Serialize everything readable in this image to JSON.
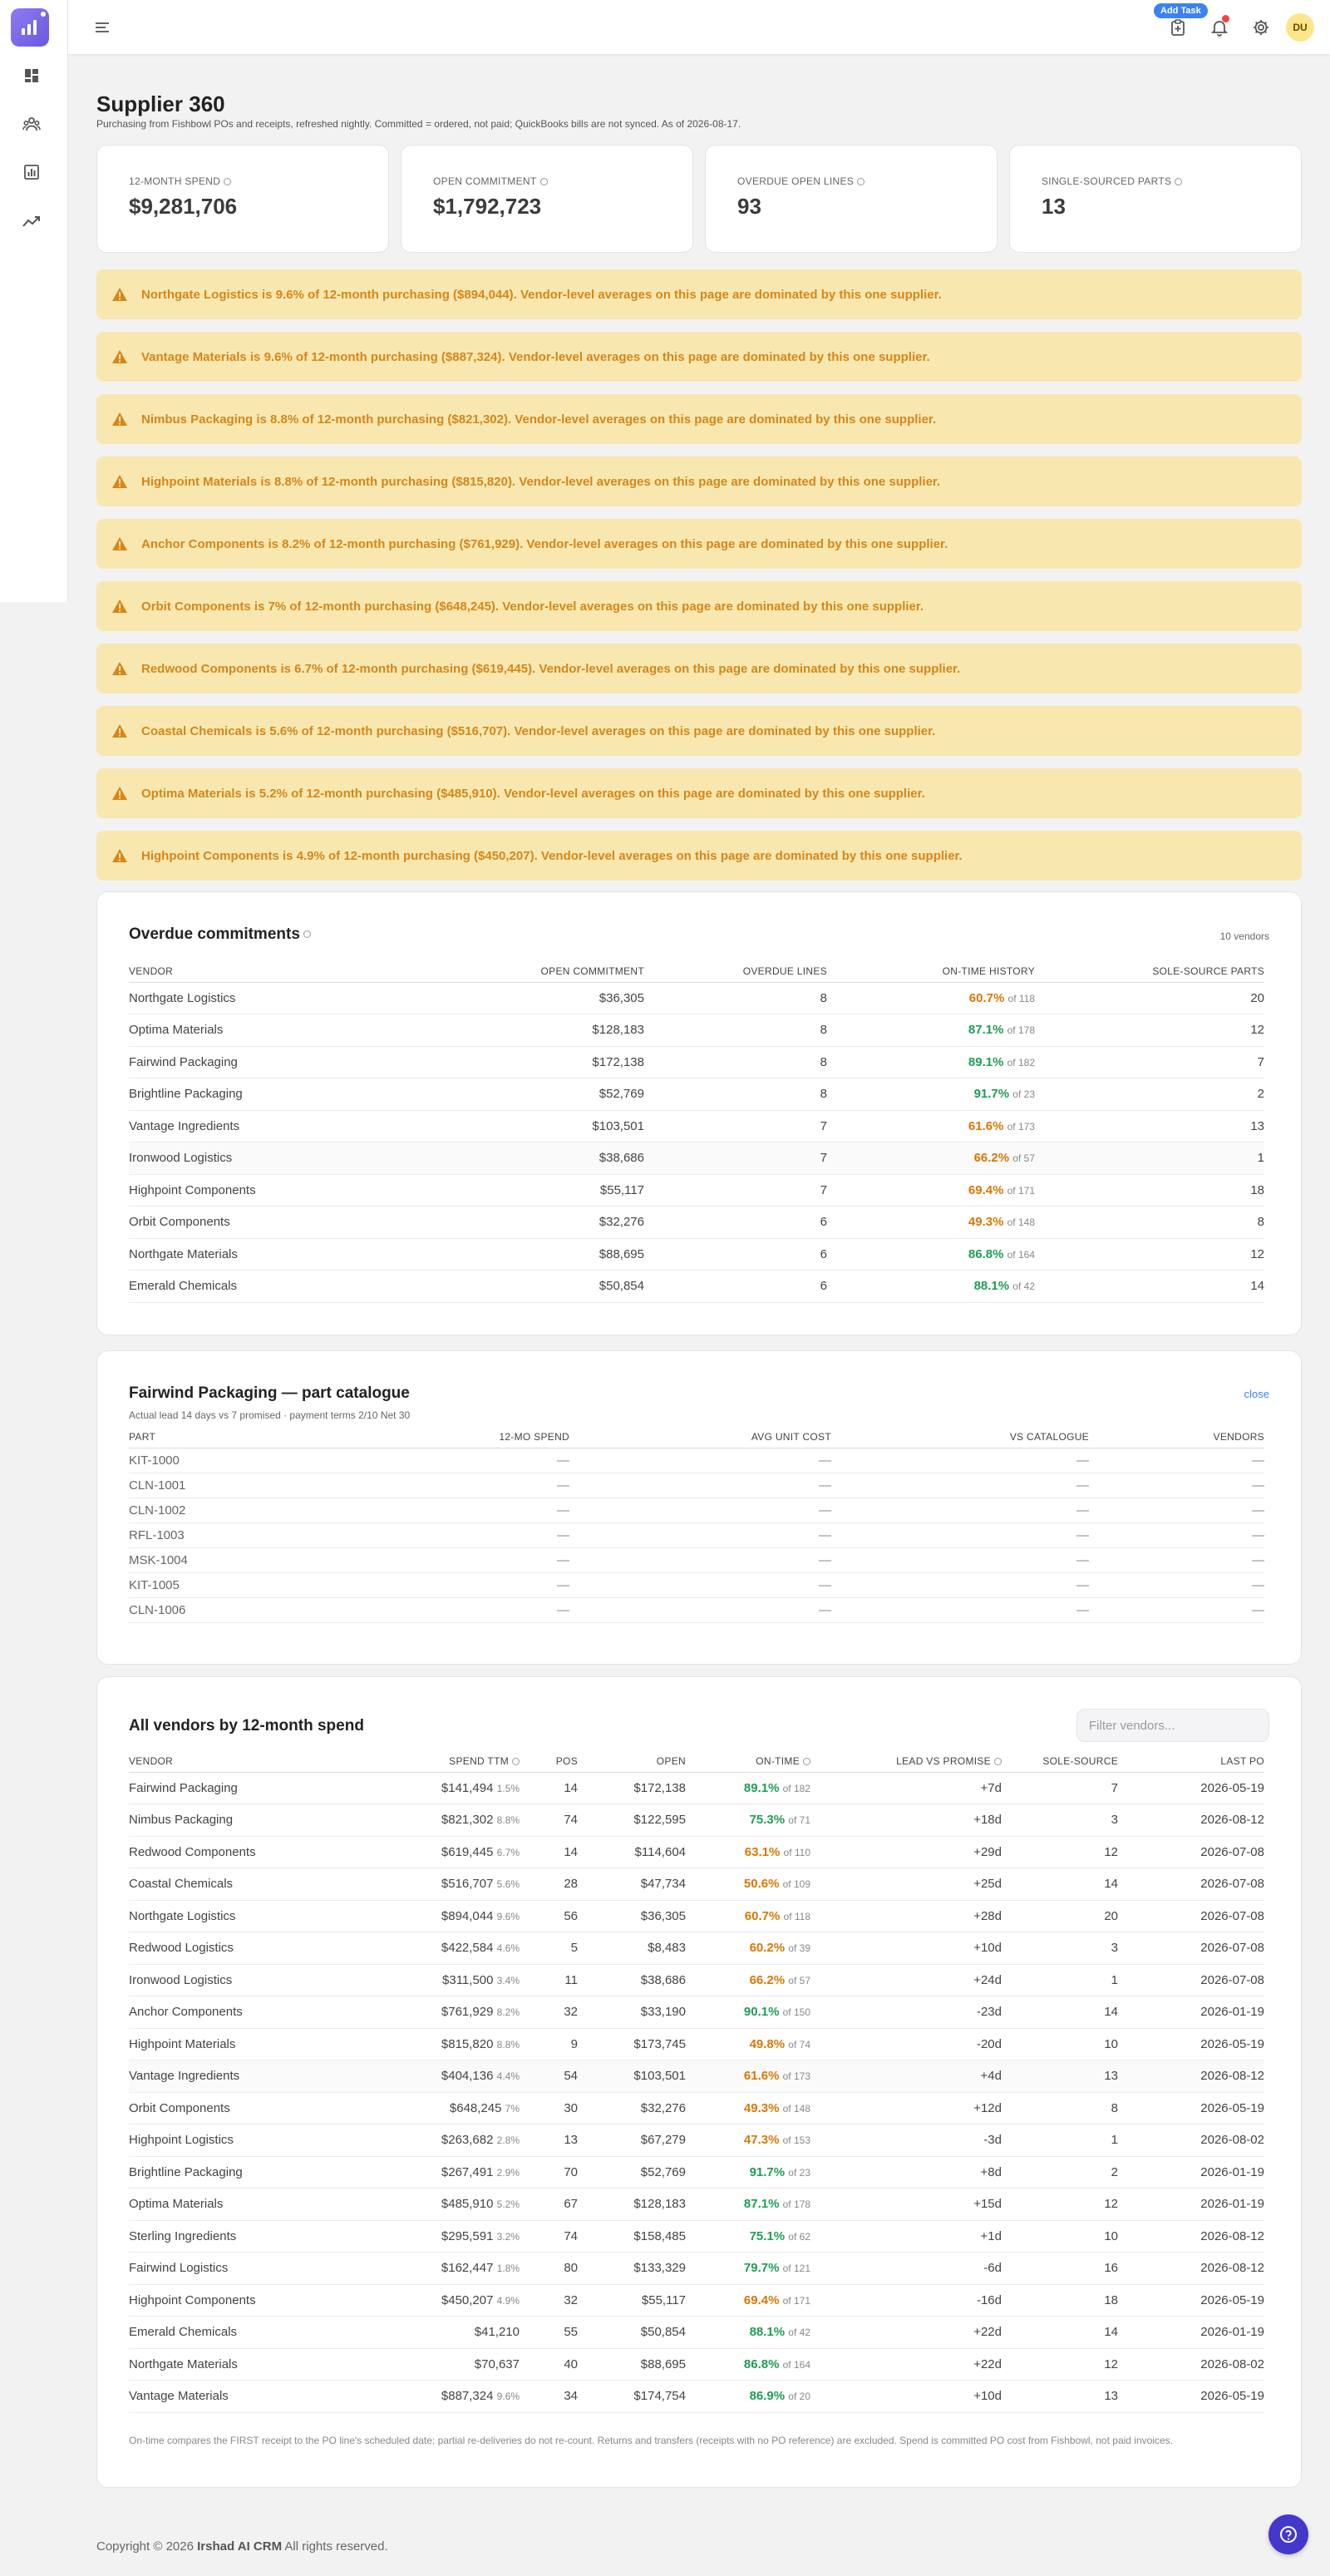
{
  "topbar": {
    "add_task_label": "Add Task",
    "avatar_initials": "DU"
  },
  "page": {
    "title": "Supplier 360",
    "subtitle": "Purchasing from Fishbowl POs and receipts, refreshed nightly. Committed = ordered, not paid; QuickBooks bills are not synced. As of 2026-08-17."
  },
  "kpis": [
    {
      "label": "12-MONTH SPEND",
      "value": "$9,281,706"
    },
    {
      "label": "OPEN COMMITMENT",
      "value": "$1,792,723"
    },
    {
      "label": "OVERDUE OPEN LINES",
      "value": "93"
    },
    {
      "label": "SINGLE-SOURCED PARTS",
      "value": "13"
    }
  ],
  "alerts": [
    "Northgate Logistics is 9.6% of 12-month purchasing ($894,044). Vendor-level averages on this page are dominated by this one supplier.",
    "Vantage Materials is 9.6% of 12-month purchasing ($887,324). Vendor-level averages on this page are dominated by this one supplier.",
    "Nimbus Packaging is 8.8% of 12-month purchasing ($821,302). Vendor-level averages on this page are dominated by this one supplier.",
    "Highpoint Materials is 8.8% of 12-month purchasing ($815,820). Vendor-level averages on this page are dominated by this one supplier.",
    "Anchor Components is 8.2% of 12-month purchasing ($761,929). Vendor-level averages on this page are dominated by this one supplier.",
    "Orbit Components is 7% of 12-month purchasing ($648,245). Vendor-level averages on this page are dominated by this one supplier.",
    "Redwood Components is 6.7% of 12-month purchasing ($619,445). Vendor-level averages on this page are dominated by this one supplier.",
    "Coastal Chemicals is 5.6% of 12-month purchasing ($516,707). Vendor-level averages on this page are dominated by this one supplier.",
    "Optima Materials is 5.2% of 12-month purchasing ($485,910). Vendor-level averages on this page are dominated by this one supplier.",
    "Highpoint Components is 4.9% of 12-month purchasing ($450,207). Vendor-level averages on this page are dominated by this one supplier."
  ],
  "overdue": {
    "title": "Overdue commitments",
    "count": "10 vendors",
    "columns": [
      "VENDOR",
      "OPEN COMMITMENT",
      "OVERDUE LINES",
      "ON-TIME HISTORY",
      "SOLE-SOURCE PARTS"
    ],
    "rows": [
      {
        "vendor": "Northgate Logistics",
        "open": "$36,305",
        "lines": "8",
        "ontime": "60.7%",
        "of": "of 118",
        "tone": "warn",
        "sole": "20"
      },
      {
        "vendor": "Optima Materials",
        "open": "$128,183",
        "lines": "8",
        "ontime": "87.1%",
        "of": "of 178",
        "tone": "good",
        "sole": "12"
      },
      {
        "vendor": "Fairwind Packaging",
        "open": "$172,138",
        "lines": "8",
        "ontime": "89.1%",
        "of": "of 182",
        "tone": "good",
        "sole": "7"
      },
      {
        "vendor": "Brightline Packaging",
        "open": "$52,769",
        "lines": "8",
        "ontime": "91.7%",
        "of": "of 23",
        "tone": "good",
        "sole": "2"
      },
      {
        "vendor": "Vantage Ingredients",
        "open": "$103,501",
        "lines": "7",
        "ontime": "61.6%",
        "of": "of 173",
        "tone": "warn",
        "sole": "13"
      },
      {
        "vendor": "Ironwood Logistics",
        "open": "$38,686",
        "lines": "7",
        "ontime": "66.2%",
        "of": "of 57",
        "tone": "warn",
        "sole": "1"
      },
      {
        "vendor": "Highpoint Components",
        "open": "$55,117",
        "lines": "7",
        "ontime": "69.4%",
        "of": "of 171",
        "tone": "warn",
        "sole": "18"
      },
      {
        "vendor": "Orbit Components",
        "open": "$32,276",
        "lines": "6",
        "ontime": "49.3%",
        "of": "of 148",
        "tone": "warn",
        "sole": "8"
      },
      {
        "vendor": "Northgate Materials",
        "open": "$88,695",
        "lines": "6",
        "ontime": "86.8%",
        "of": "of 164",
        "tone": "good",
        "sole": "12"
      },
      {
        "vendor": "Emerald Chemicals",
        "open": "$50,854",
        "lines": "6",
        "ontime": "88.1%",
        "of": "of 42",
        "tone": "good",
        "sole": "14"
      }
    ]
  },
  "catalogue": {
    "title": "Fairwind Packaging — part catalogue",
    "subtitle": "Actual lead 14 days vs 7 promised · payment terms 2/10 Net 30",
    "close_label": "close",
    "columns": [
      "PART",
      "12-MO SPEND",
      "AVG UNIT COST",
      "VS CATALOGUE",
      "VENDORS"
    ],
    "dash": "—",
    "parts": [
      "KIT-1000",
      "CLN-1001",
      "CLN-1002",
      "RFL-1003",
      "MSK-1004",
      "KIT-1005",
      "CLN-1006"
    ]
  },
  "vendors": {
    "title": "All vendors by 12-month spend",
    "filter_placeholder": "Filter vendors...",
    "columns": [
      "VENDOR",
      "SPEND TTM",
      "POS",
      "OPEN",
      "ON-TIME",
      "LEAD VS PROMISE",
      "SOLE-SOURCE",
      "LAST PO"
    ],
    "rows": [
      {
        "vendor": "Fairwind Packaging",
        "spend": "$141,494",
        "pct": "1.5%",
        "pos": "14",
        "open": "$172,138",
        "ontime": "89.1%",
        "of": "of 182",
        "tone": "good",
        "lead": "+7d",
        "sole": "7",
        "last": "2026-05-19"
      },
      {
        "vendor": "Nimbus Packaging",
        "spend": "$821,302",
        "pct": "8.8%",
        "pos": "74",
        "open": "$122,595",
        "ontime": "75.3%",
        "of": "of 71",
        "tone": "good",
        "lead": "+18d",
        "sole": "3",
        "last": "2026-08-12"
      },
      {
        "vendor": "Redwood Components",
        "spend": "$619,445",
        "pct": "6.7%",
        "pos": "14",
        "open": "$114,604",
        "ontime": "63.1%",
        "of": "of 110",
        "tone": "warn",
        "lead": "+29d",
        "sole": "12",
        "last": "2026-07-08"
      },
      {
        "vendor": "Coastal Chemicals",
        "spend": "$516,707",
        "pct": "5.6%",
        "pos": "28",
        "open": "$47,734",
        "ontime": "50.6%",
        "of": "of 109",
        "tone": "warn",
        "lead": "+25d",
        "sole": "14",
        "last": "2026-07-08"
      },
      {
        "vendor": "Northgate Logistics",
        "spend": "$894,044",
        "pct": "9.6%",
        "pos": "56",
        "open": "$36,305",
        "ontime": "60.7%",
        "of": "of 118",
        "tone": "warn",
        "lead": "+28d",
        "sole": "20",
        "last": "2026-07-08"
      },
      {
        "vendor": "Redwood Logistics",
        "spend": "$422,584",
        "pct": "4.6%",
        "pos": "5",
        "open": "$8,483",
        "ontime": "60.2%",
        "of": "of 39",
        "tone": "warn",
        "lead": "+10d",
        "sole": "3",
        "last": "2026-07-08"
      },
      {
        "vendor": "Ironwood Logistics",
        "spend": "$311,500",
        "pct": "3.4%",
        "pos": "11",
        "open": "$38,686",
        "ontime": "66.2%",
        "of": "of 57",
        "tone": "warn",
        "lead": "+24d",
        "sole": "1",
        "last": "2026-07-08"
      },
      {
        "vendor": "Anchor Components",
        "spend": "$761,929",
        "pct": "8.2%",
        "pos": "32",
        "open": "$33,190",
        "ontime": "90.1%",
        "of": "of 150",
        "tone": "good",
        "lead": "-23d",
        "sole": "14",
        "last": "2026-01-19"
      },
      {
        "vendor": "Highpoint Materials",
        "spend": "$815,820",
        "pct": "8.8%",
        "pos": "9",
        "open": "$173,745",
        "ontime": "49.8%",
        "of": "of 74",
        "tone": "warn",
        "lead": "-20d",
        "sole": "10",
        "last": "2026-05-19"
      },
      {
        "vendor": "Vantage Ingredients",
        "spend": "$404,136",
        "pct": "4.4%",
        "pos": "54",
        "open": "$103,501",
        "ontime": "61.6%",
        "of": "of 173",
        "tone": "warn",
        "lead": "+4d",
        "sole": "13",
        "last": "2026-08-12"
      },
      {
        "vendor": "Orbit Components",
        "spend": "$648,245",
        "pct": "7%",
        "pos": "30",
        "open": "$32,276",
        "ontime": "49.3%",
        "of": "of 148",
        "tone": "warn",
        "lead": "+12d",
        "sole": "8",
        "last": "2026-05-19"
      },
      {
        "vendor": "Highpoint Logistics",
        "spend": "$263,682",
        "pct": "2.8%",
        "pos": "13",
        "open": "$67,279",
        "ontime": "47.3%",
        "of": "of 153",
        "tone": "warn",
        "lead": "-3d",
        "sole": "1",
        "last": "2026-08-02"
      },
      {
        "vendor": "Brightline Packaging",
        "spend": "$267,491",
        "pct": "2.9%",
        "pos": "70",
        "open": "$52,769",
        "ontime": "91.7%",
        "of": "of 23",
        "tone": "good",
        "lead": "+8d",
        "sole": "2",
        "last": "2026-01-19"
      },
      {
        "vendor": "Optima Materials",
        "spend": "$485,910",
        "pct": "5.2%",
        "pos": "67",
        "open": "$128,183",
        "ontime": "87.1%",
        "of": "of 178",
        "tone": "good",
        "lead": "+15d",
        "sole": "12",
        "last": "2026-01-19"
      },
      {
        "vendor": "Sterling Ingredients",
        "spend": "$295,591",
        "pct": "3.2%",
        "pos": "74",
        "open": "$158,485",
        "ontime": "75.1%",
        "of": "of 62",
        "tone": "good",
        "lead": "+1d",
        "sole": "10",
        "last": "2026-08-12"
      },
      {
        "vendor": "Fairwind Logistics",
        "spend": "$162,447",
        "pct": "1.8%",
        "pos": "80",
        "open": "$133,329",
        "ontime": "79.7%",
        "of": "of 121",
        "tone": "good",
        "lead": "-6d",
        "sole": "16",
        "last": "2026-08-12"
      },
      {
        "vendor": "Highpoint Components",
        "spend": "$450,207",
        "pct": "4.9%",
        "pos": "32",
        "open": "$55,117",
        "ontime": "69.4%",
        "of": "of 171",
        "tone": "warn",
        "lead": "-16d",
        "sole": "18",
        "last": "2026-05-19"
      },
      {
        "vendor": "Emerald Chemicals",
        "spend": "$41,210",
        "pct": "",
        "pos": "55",
        "open": "$50,854",
        "ontime": "88.1%",
        "of": "of 42",
        "tone": "good",
        "lead": "+22d",
        "sole": "14",
        "last": "2026-01-19"
      },
      {
        "vendor": "Northgate Materials",
        "spend": "$70,637",
        "pct": "",
        "pos": "40",
        "open": "$88,695",
        "ontime": "86.8%",
        "of": "of 164",
        "tone": "good",
        "lead": "+22d",
        "sole": "12",
        "last": "2026-08-02"
      },
      {
        "vendor": "Vantage Materials",
        "spend": "$887,324",
        "pct": "9.6%",
        "pos": "34",
        "open": "$174,754",
        "ontime": "86.9%",
        "of": "of 20",
        "tone": "good",
        "lead": "+10d",
        "sole": "13",
        "last": "2026-05-19"
      }
    ],
    "footnote": "On-time compares the FIRST receipt to the PO line's scheduled date; partial re-deliveries do not re-count. Returns and transfers (receipts with no PO reference) are excluded. Spend is committed PO cost from Fishbowl, not paid invoices."
  },
  "footer": {
    "prefix": "Copyright © 2026",
    "brand": "Irshad AI CRM",
    "suffix": "All rights reserved."
  },
  "colors": {
    "accent": "#6a57e0",
    "good": "#1f9d55",
    "warn": "#d97706",
    "alert_bg": "#f8e8b0",
    "link": "#3b82f6"
  }
}
